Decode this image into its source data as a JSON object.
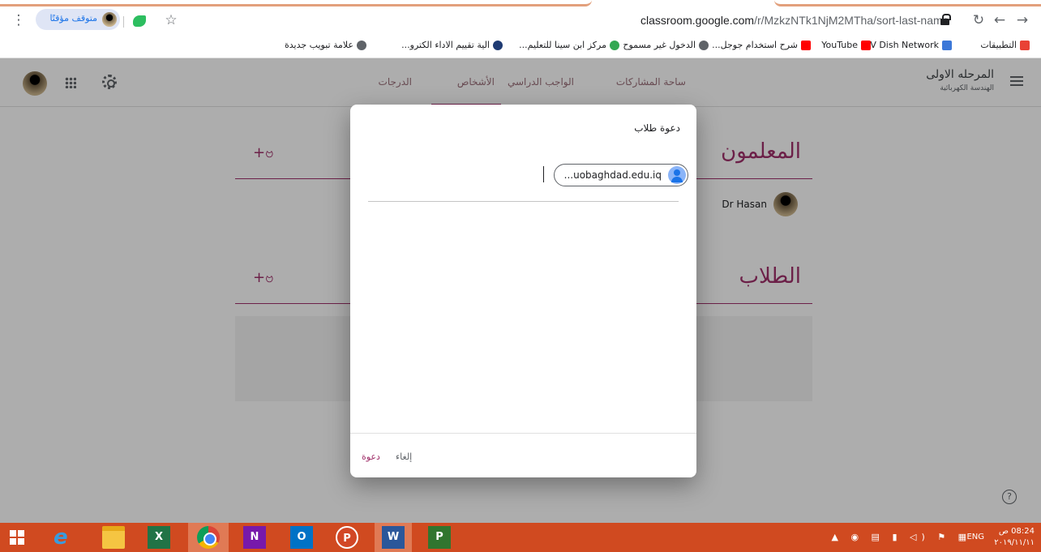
{
  "browser": {
    "url_host": "classroom.google.com",
    "url_path": "/r/MzkzNTk1NjM2MTha/sort-last-name",
    "profile_status": "متوقف مؤقتًا",
    "bookmarks": [
      {
        "label": "التطبيقات",
        "icon": "apps-grid-icon",
        "color": "#e94235"
      },
      {
        "label": "TV Dish Network",
        "icon": "bookmark-icon",
        "color": "#3c78d8"
      },
      {
        "label": "YouTube",
        "icon": "youtube-icon",
        "color": "#ff0000"
      },
      {
        "label": "شرح استخدام جوجل...",
        "icon": "youtube-icon",
        "color": "#ff0000"
      },
      {
        "label": "الدخول غير مسموح",
        "icon": "globe-icon",
        "color": "#5f6368"
      },
      {
        "label": "مركز ابن سينا للتعليم...",
        "icon": "hand-icon",
        "color": "#34a853"
      },
      {
        "label": "الية تقييم الاداء الكترو...",
        "icon": "shield-icon",
        "color": "#1f3b73"
      },
      {
        "label": "علامة تبويب جديدة",
        "icon": "globe-icon",
        "color": "#5f6368"
      }
    ]
  },
  "app": {
    "class_title": "المرحله الاولى",
    "class_subtitle": "الهندسة الكهربائية",
    "tabs": [
      "ساحة المشاركات",
      "الواجب الدراسي",
      "الأشخاص",
      "الدرجات"
    ],
    "active_tab": "الأشخاص",
    "teachers_heading": "المعلمون",
    "students_heading": "الطلاب",
    "teacher_name": "Dr Hasan",
    "accent": "#a0306a"
  },
  "dialog": {
    "title": "دعوة طلاب",
    "chip_text": "...uobaghdad.edu.iq",
    "invite_label": "دعوة",
    "cancel_label": "إلغاء"
  },
  "taskbar": {
    "language": "ENG",
    "time": "08:24 ص",
    "date": "٢٠١٩/١١/١١"
  }
}
